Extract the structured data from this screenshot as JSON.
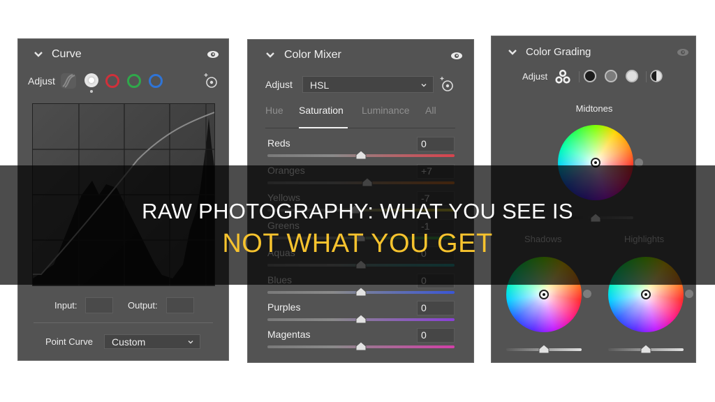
{
  "curve_panel": {
    "title": "Curve",
    "adjust_label": "Adjust",
    "channels": [
      {
        "name": "parametric",
        "icon": "parametric-curve-icon"
      },
      {
        "name": "point-white",
        "icon": "white-channel-icon",
        "selected": true
      },
      {
        "name": "red",
        "color": "#d0303a"
      },
      {
        "name": "green",
        "color": "#2fa84a"
      },
      {
        "name": "blue",
        "color": "#2f74d6"
      }
    ],
    "input_label": "Input:",
    "input_value": "",
    "output_label": "Output:",
    "output_value": "",
    "point_curve_label": "Point Curve",
    "point_curve_value": "Custom"
  },
  "color_mixer_panel": {
    "title": "Color Mixer",
    "adjust_label": "Adjust",
    "adjust_value": "HSL",
    "tabs": [
      {
        "label": "Hue",
        "active": false
      },
      {
        "label": "Saturation",
        "active": true
      },
      {
        "label": "Luminance",
        "active": false
      },
      {
        "label": "All",
        "active": false
      }
    ],
    "rows": [
      {
        "label": "Reds",
        "value": "0",
        "num": 0,
        "color": "#d8434d"
      },
      {
        "label": "Oranges",
        "value": "+7",
        "num": 7,
        "color": "#d9782c"
      },
      {
        "label": "Yellows",
        "value": "-7",
        "num": -7,
        "color": "#cfc233"
      },
      {
        "label": "Greens",
        "value": "-1",
        "num": -1,
        "color": "#3aaa44"
      },
      {
        "label": "Aquas",
        "value": "0",
        "num": 0,
        "color": "#2fa5a2"
      },
      {
        "label": "Blues",
        "value": "0",
        "num": 0,
        "color": "#3a56d6"
      },
      {
        "label": "Purples",
        "value": "0",
        "num": 0,
        "color": "#8a40d8"
      },
      {
        "label": "Magentas",
        "value": "0",
        "num": 0,
        "color": "#d23fa8"
      }
    ]
  },
  "color_grading_panel": {
    "title": "Color Grading",
    "adjust_label": "Adjust",
    "wheels": [
      {
        "label": "Midtones",
        "luminance": 0.5
      },
      {
        "label": "Shadows",
        "luminance": 0.5
      },
      {
        "label": "Highlights",
        "luminance": 0.5
      }
    ]
  },
  "overlay": {
    "line1": "RAW PHOTOGRAPHY: WHAT YOU SEE IS",
    "line2": "NOT WHAT YOU GET",
    "line2_color": "#f7c32e"
  }
}
